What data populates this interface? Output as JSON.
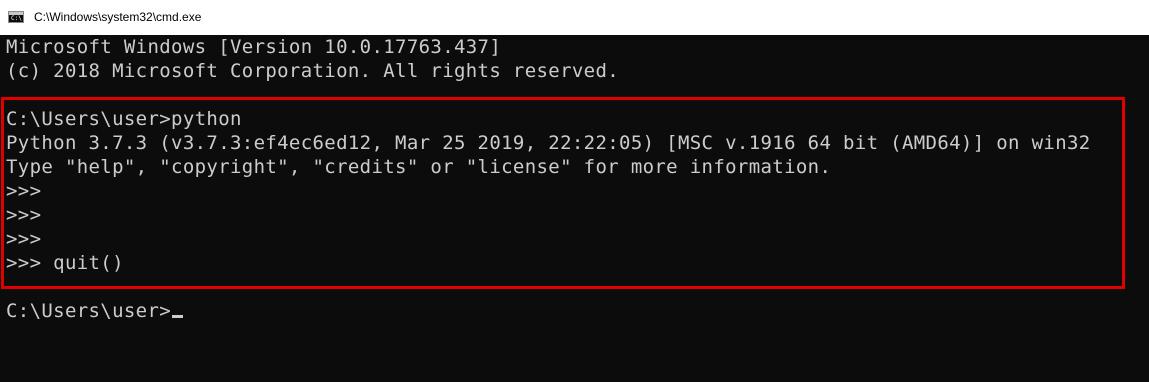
{
  "window": {
    "title": "C:\\Windows\\system32\\cmd.exe",
    "icon": "cmd-console-icon",
    "icon_prompt": "C:\\"
  },
  "console": {
    "lines": [
      "Microsoft Windows [Version 10.0.17763.437]",
      "(c) 2018 Microsoft Corporation. All rights reserved.",
      "",
      "C:\\Users\\user>python",
      "Python 3.7.3 (v3.7.3:ef4ec6ed12, Mar 25 2019, 22:22:05) [MSC v.1916 64 bit (AMD64)] on win32",
      "Type \"help\", \"copyright\", \"credits\" or \"license\" for more information.",
      ">>>",
      ">>>",
      ">>>",
      ">>> quit()",
      "",
      "C:\\Users\\user>"
    ]
  },
  "colors": {
    "console_background": "#0c0c0c",
    "console_text": "#cccccc",
    "highlight_border": "#e00000",
    "titlebar_background": "#ffffff"
  }
}
